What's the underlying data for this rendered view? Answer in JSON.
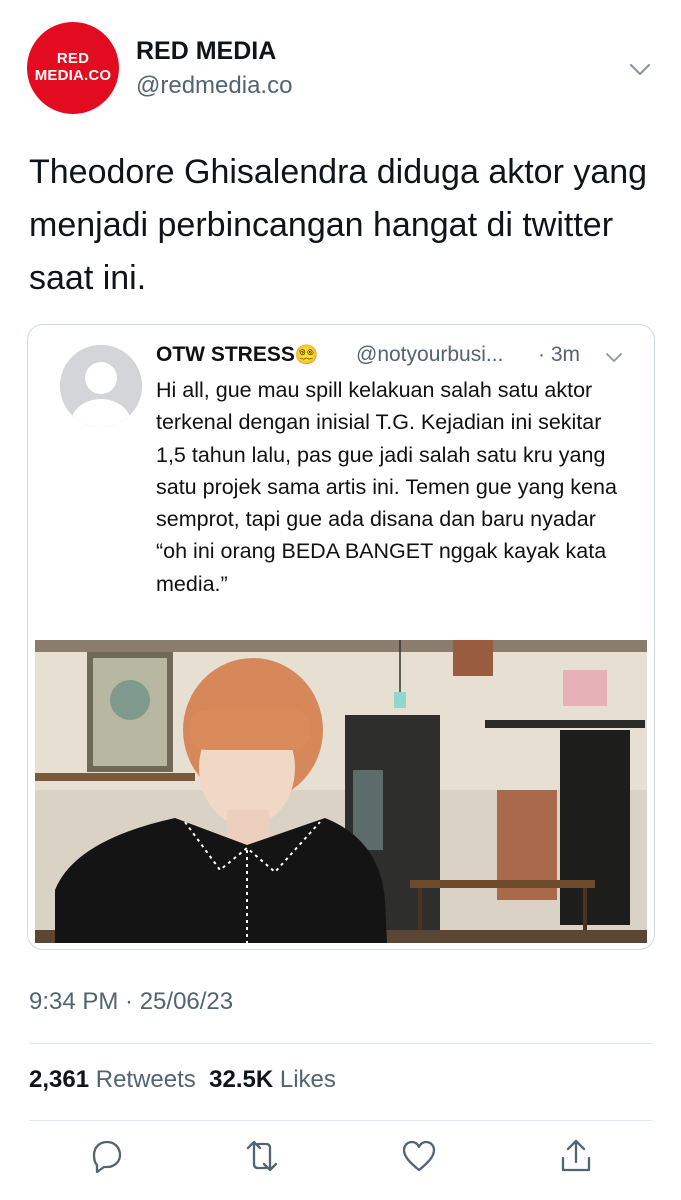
{
  "tweet": {
    "avatar": {
      "line1": "RED",
      "line2": "MEDIA.CO",
      "color": "#e30b1f"
    },
    "display_name": "RED MEDIA",
    "handle": "@redmedia.co",
    "text": "Theodore Ghisalendra diduga aktor yang menjadi perbincangan hangat di twitter saat ini."
  },
  "quoted": {
    "name": "OTW STRESS",
    "emoji": "😵‍💫",
    "handle": "@notyourbusi...",
    "time": "· 3m",
    "text": "Hi all, gue mau spill kelakuan salah satu aktor terkenal dengan inisial T.G. Kejadian ini sekitar 1,5 tahun lalu, pas gue jadi salah satu kru yang satu projek sama artis ini. Temen gue yang kena semprot, tapi gue ada disana dan baru nyadar “oh ini orang BEDA BANGET nggak kayak kata media.”"
  },
  "meta": {
    "timestamp": "9:34 PM · 25/06/23"
  },
  "stats": {
    "retweets_count": "2,361",
    "retweets_label": "Retweets",
    "likes_count": "32.5K",
    "likes_label": "Likes"
  },
  "icons": {
    "reply": "reply-icon",
    "retweet": "retweet-icon",
    "like": "heart-icon",
    "share": "share-icon",
    "accent": "#536471"
  }
}
